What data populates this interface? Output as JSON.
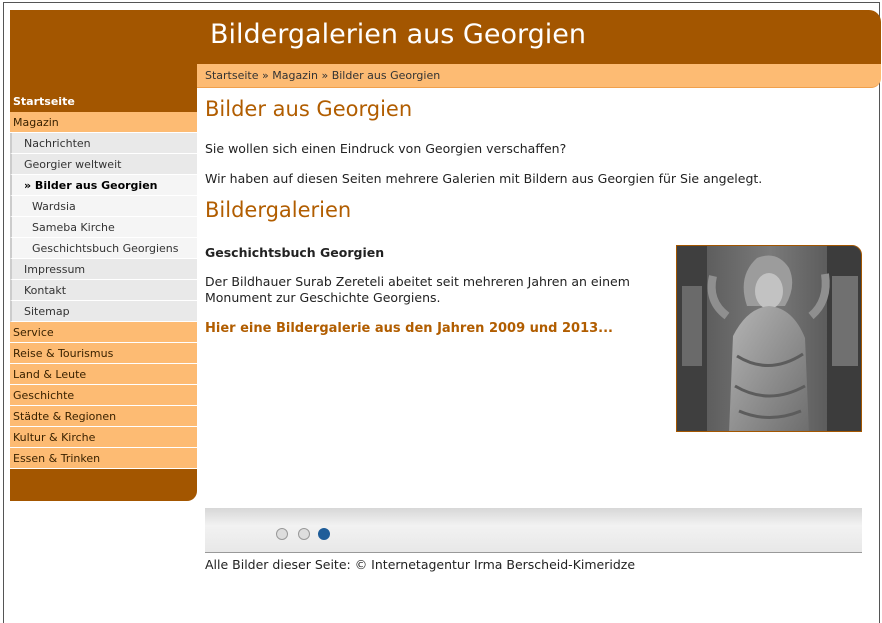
{
  "header": {
    "site_title": "Bildergalerien aus Georgien"
  },
  "breadcrumb": {
    "text": "Startseite » Magazin » Bilder aus Georgien"
  },
  "sidebar": {
    "items": [
      {
        "label": "Startseite",
        "kind": "top"
      },
      {
        "label": "Magazin",
        "kind": "main"
      },
      {
        "label": "Nachrichten",
        "kind": "sub"
      },
      {
        "label": "Georgier weltweit",
        "kind": "sub"
      },
      {
        "label": "» Bilder aus Georgien",
        "kind": "active"
      },
      {
        "label": "Wardsia",
        "kind": "sub2"
      },
      {
        "label": "Sameba Kirche",
        "kind": "sub2"
      },
      {
        "label": "Geschichtsbuch Georgiens",
        "kind": "sub2"
      },
      {
        "label": "Impressum",
        "kind": "sub"
      },
      {
        "label": "Kontakt",
        "kind": "sub"
      },
      {
        "label": "Sitemap",
        "kind": "sub"
      },
      {
        "label": "Service",
        "kind": "main"
      },
      {
        "label": "Reise & Tourismus",
        "kind": "main"
      },
      {
        "label": "Land & Leute",
        "kind": "main"
      },
      {
        "label": "Geschichte",
        "kind": "main"
      },
      {
        "label": "Städte & Regionen",
        "kind": "main"
      },
      {
        "label": "Kultur & Kirche",
        "kind": "main"
      },
      {
        "label": "Essen & Trinken",
        "kind": "main"
      }
    ]
  },
  "main": {
    "title": "Bilder aus Georgien",
    "intro1": "Sie wollen sich einen Eindruck von Georgien verschaffen?",
    "intro2": "Wir haben auf diesen Seiten mehrere Galerien mit Bildern aus Georgien für Sie angelegt.",
    "section_title": "Bildergalerien",
    "gallery": {
      "title": "Geschichtsbuch Georgien",
      "text": "Der Bildhauer Surab Zereteli abeitet seit mehreren Jahren an einem Monument zur Geschichte Georgiens.",
      "link": "Hier eine Bildergalerie aus den Jahren 2009 und 2013..."
    }
  },
  "slider": {
    "dots": 3,
    "active_dot": 3
  },
  "footer": {
    "credit": "Alle Bilder dieser Seite: © Internetagentur Irma Berscheid-Kimeridze"
  },
  "colors": {
    "brand": "#a35600",
    "nav_main": "#fdbb73",
    "link": "#b15d00",
    "dot_active": "#1f5d99"
  }
}
